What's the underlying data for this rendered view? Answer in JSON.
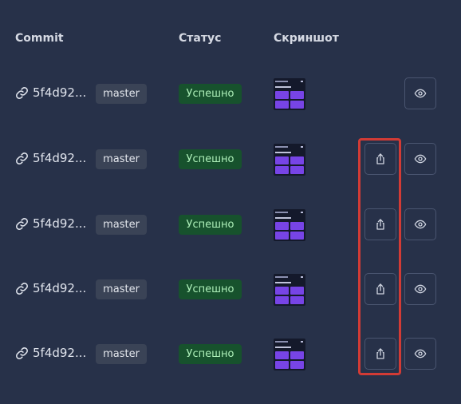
{
  "table": {
    "headers": {
      "commit": "Commit",
      "status": "Статус",
      "screenshot": "Скриншот"
    },
    "rows": [
      {
        "commit": "5f4d92...",
        "branch": "master",
        "status": "Успешно",
        "has_share": false
      },
      {
        "commit": "5f4d92...",
        "branch": "master",
        "status": "Успешно",
        "has_share": true
      },
      {
        "commit": "5f4d92...",
        "branch": "master",
        "status": "Успешно",
        "has_share": true
      },
      {
        "commit": "5f4d92...",
        "branch": "master",
        "status": "Успешно",
        "has_share": true
      },
      {
        "commit": "5f4d92...",
        "branch": "master",
        "status": "Успешно",
        "has_share": true
      }
    ]
  },
  "icons": {
    "link": "link-icon",
    "share": "share-icon",
    "view": "eye-icon"
  },
  "colors": {
    "background": "#273149",
    "branch_badge": "#3a4356",
    "status_badge_bg": "#17522d",
    "status_badge_text": "#aef0b9",
    "thumbnail_tile": "#7744e6",
    "highlight": "#d23b35"
  }
}
